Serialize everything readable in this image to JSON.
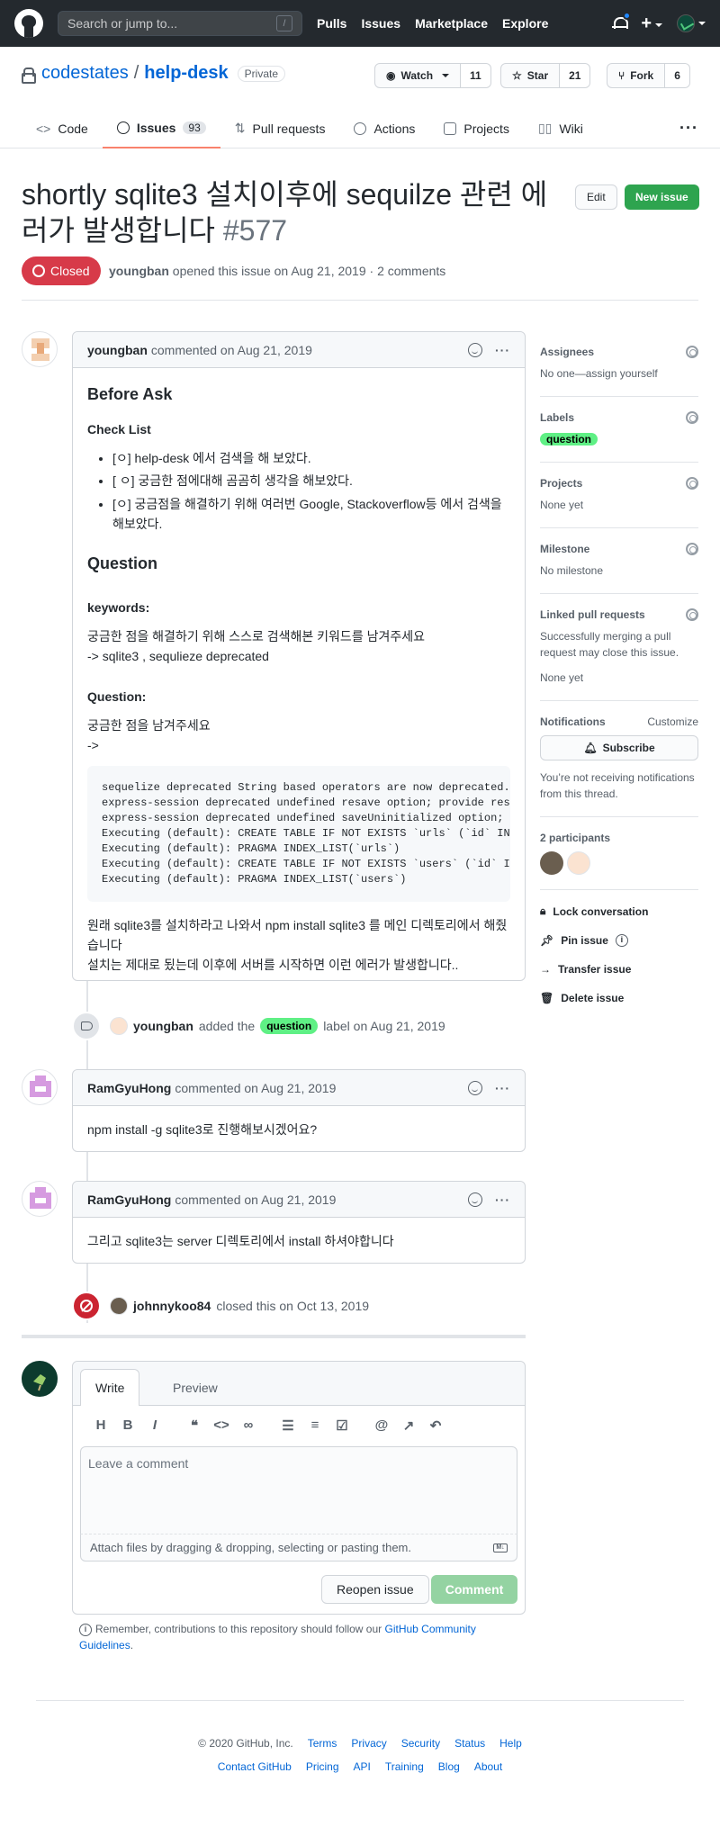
{
  "header": {
    "search_placeholder": "Search or jump to...",
    "search_key": "/",
    "nav": [
      "Pulls",
      "Issues",
      "Marketplace",
      "Explore"
    ]
  },
  "repo": {
    "owner": "codestates",
    "name": "help-desk",
    "visibility": "Private",
    "watch_label": "Watch",
    "watch_count": "11",
    "star_label": "Star",
    "star_count": "21",
    "fork_label": "Fork",
    "fork_count": "6"
  },
  "tabs": [
    {
      "label": "Code"
    },
    {
      "label": "Issues",
      "count": "93"
    },
    {
      "label": "Pull requests"
    },
    {
      "label": "Actions"
    },
    {
      "label": "Projects"
    },
    {
      "label": "Wiki"
    }
  ],
  "issue": {
    "title": "shortly sqlite3 설치이후에 sequilze 관련 에러가 발생합니다",
    "number": "#577",
    "edit_label": "Edit",
    "new_issue_label": "New issue",
    "state": "Closed",
    "author": "youngban",
    "meta_text": "opened this issue on Aug 21, 2019 · 2 comments"
  },
  "first_comment": {
    "author": "youngban",
    "when": "commented on Aug 21, 2019",
    "h_before": "Before Ask",
    "h_check": "Check List",
    "checklist": [
      "[ㅇ] help-desk 에서 검색을 해 보았다.",
      "[ ㅇ] 궁금한 점에대해 곰곰히 생각을 해보았다.",
      "[ㅇ] 궁금점을 해결하기 위해 여러번 Google, Stackoverflow등 에서 검색을 해보았다."
    ],
    "h_question": "Question",
    "h_keywords": "keywords:",
    "keywords_line1": "궁금한 점을 해결하기 위해 스스로 검색해본 키워드를 남겨주세요",
    "keywords_line2": "-> sqlite3 , sequlieze deprecated",
    "h_question2": "Question:",
    "question_line1": "궁금한 점을 남겨주세요",
    "question_line2": "->",
    "code": "sequelize deprecated String based operators are now deprecated. Please use Symbol based operators for better security\nexpress-session deprecated undefined resave option; provide resave option\nexpress-session deprecated undefined saveUninitialized option; provide saveUninitialized option\nExecuting (default): CREATE TABLE IF NOT EXISTS `urls` (`id` INTEGER PRIMARY KEY AUTOINCREMENT)\nExecuting (default): PRAGMA INDEX_LIST(`urls`)\nExecuting (default): CREATE TABLE IF NOT EXISTS `users` (`id` INTEGER PRIMARY KEY AUTOINCREMENT)\nExecuting (default): PRAGMA INDEX_LIST(`users`)",
    "outro_line1": "원래 sqlite3를 설치하라고 나와서 npm install sqlite3 를 메인 디렉토리에서 해줬습니다",
    "outro_line2": "설치는 제대로 됬는데 이후에 서버를 시작하면 이런 에러가 발생합니다.."
  },
  "label_event": {
    "actor": "youngban",
    "pre": "added the",
    "label": "question",
    "post": "label on Aug 21, 2019"
  },
  "comments": [
    {
      "author": "RamGyuHong",
      "when": "commented on Aug 21, 2019",
      "body": "npm install -g sqlite3로 진행해보시겠어요?"
    },
    {
      "author": "RamGyuHong",
      "when": "commented on Aug 21, 2019",
      "body": "그리고 sqlite3는 server 디렉토리에서 install 하셔야합니다"
    }
  ],
  "close_event": {
    "actor": "johnnykoo84",
    "text": "closed this on Oct 13, 2019"
  },
  "sidebar": {
    "assignees_h": "Assignees",
    "assignees_t": "No one—assign yourself",
    "labels_h": "Labels",
    "label": "question",
    "projects_h": "Projects",
    "projects_t": "None yet",
    "milestone_h": "Milestone",
    "milestone_t": "No milestone",
    "linked_h": "Linked pull requests",
    "linked_t": "Successfully merging a pull request may close this issue.",
    "linked_t2": "None yet",
    "notif_h": "Notifications",
    "customize": "Customize",
    "subscribe": "Subscribe",
    "notif_t": "You’re not receiving notifications from this thread.",
    "participants_h": "2 participants",
    "actions": [
      "Lock conversation",
      "Pin issue",
      "Transfer issue",
      "Delete issue"
    ]
  },
  "new_comment": {
    "write_tab": "Write",
    "preview_tab": "Preview",
    "placeholder": "Leave a comment",
    "attach_text": "Attach files by dragging & dropping, selecting or pasting them.",
    "reopen": "Reopen issue",
    "submit": "Comment",
    "remember_pre": "Remember, contributions to this repository should follow our",
    "remember_link": "GitHub Community Guidelines",
    "remember_post": "."
  },
  "footer": {
    "copyright": "© 2020 GitHub, Inc.",
    "row1": [
      "Terms",
      "Privacy",
      "Security",
      "Status",
      "Help"
    ],
    "row2": [
      "Contact GitHub",
      "Pricing",
      "API",
      "Training",
      "Blog",
      "About"
    ]
  },
  "colors": {
    "header_bg": "#24292e",
    "link": "#0366d6",
    "closed": "#d73a49",
    "green": "#2ea44f",
    "label_question": "#5ff085"
  }
}
